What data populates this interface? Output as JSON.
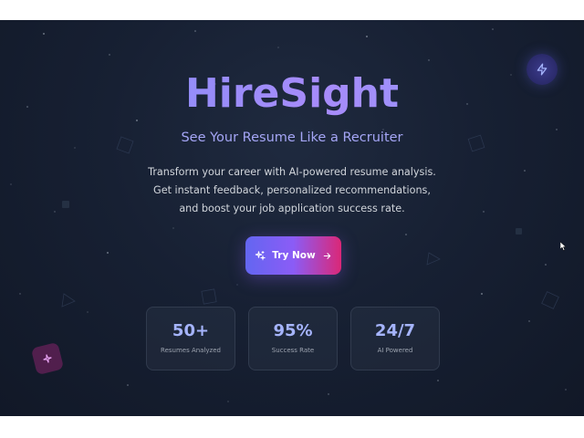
{
  "hero": {
    "brand": "HireSight",
    "tagline": "See Your Resume Like a Recruiter",
    "description": "Transform your career with AI-powered resume analysis. Get instant feedback, personalized recommendations, and boost your job application success rate."
  },
  "cta": {
    "label": "Try Now",
    "leading_icon": "sparkles-icon",
    "trailing_icon": "arrow-right-icon"
  },
  "stats": [
    {
      "value": "50+",
      "label": "Resumes Analyzed"
    },
    {
      "value": "95%",
      "label": "Success Rate"
    },
    {
      "value": "24/7",
      "label": "AI Powered"
    }
  ],
  "decorations": {
    "top_right_icon": "lightning-bolt-icon",
    "bottom_left_icon": "sparkle-icon"
  },
  "colors": {
    "background": "#172033",
    "brand_gradient_start": "#7c8ff7",
    "brand_gradient_end": "#a78bfa",
    "tagline": "#a5a6f6",
    "cta_gradient_start": "#6366f1",
    "cta_gradient_end": "#db2777",
    "stat_value": "#a5b4fc"
  }
}
